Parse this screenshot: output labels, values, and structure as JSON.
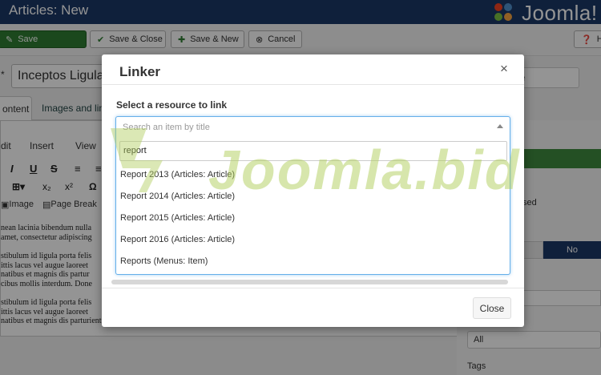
{
  "page": {
    "title": "Articles: New"
  },
  "brand": {
    "name": "Joomla!",
    "colors": {
      "topbar": "#1a3867",
      "save": "#2f7d32",
      "focus": "#66afe9"
    }
  },
  "toolbar": {
    "save": "Save",
    "save_close": "Save & Close",
    "save_new": "Save & New",
    "cancel": "Cancel",
    "help": "H"
  },
  "form": {
    "required_marker": "*",
    "title_value": "Inceptos Ligula",
    "alias_placeholder": "e",
    "tabs": [
      "ontent",
      "Images and link"
    ]
  },
  "editor": {
    "menus": [
      "dit",
      "Insert",
      "View"
    ],
    "buttons2": [
      "Image",
      "Page Break"
    ],
    "text_lines": [
      "nean lacinia bibendum nulla",
      "amet, consectetur adipiscing",
      "stibulum id ligula porta felis",
      "ittis lacus vel augue laoreet",
      "natibus et magnis dis partur",
      "cibus mollis interdum. Done",
      "stibulum id ligula porta felis",
      "ittis lacus vel augue laoreet",
      "natibus et magnis dis parturient montes, nascetur ridiculus mus."
    ]
  },
  "sidebar": {
    "label": "sed",
    "toggle_no": "No",
    "all_select": "All",
    "tags_label": "Tags"
  },
  "modal": {
    "title": "Linker",
    "close_icon": "×",
    "select_label": "Select a resource to link",
    "search_placeholder": "Search an item by title",
    "search_value": "report",
    "results": [
      "Report 2013 (Articles: Article)",
      "Report 2014 (Articles: Article)",
      "Report 2015 (Articles: Article)",
      "Report 2016 (Articles: Article)",
      "Reports (Menus: Item)"
    ],
    "close_button": "Close"
  },
  "watermark": {
    "text": "Joomla.bid"
  }
}
